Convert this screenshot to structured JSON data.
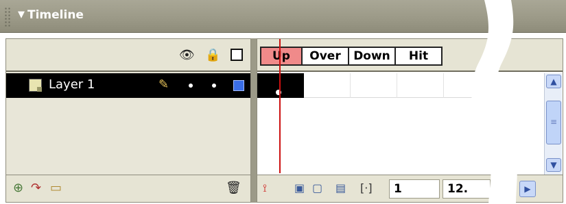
{
  "panel": {
    "title": "Timeline",
    "collapse_icon": "▼"
  },
  "layer_header": {
    "eye_icon": "👁",
    "lock_icon": "🔒"
  },
  "layers": [
    {
      "name": "Layer 1",
      "selected": true,
      "editing": true,
      "color": "#3a6ee8"
    }
  ],
  "frame_labels": [
    "Up",
    "Over",
    "Down",
    "Hit"
  ],
  "active_frame_label": "Up",
  "toolbar": {
    "current_frame": "1",
    "frame_rate": "12."
  },
  "colors": {
    "title_bar": "#9c9a88",
    "selected_row": "#000000",
    "current_frame_highlight": "#f08a8a",
    "playhead": "#cc1010",
    "layer_color": "#3a6ee8"
  }
}
